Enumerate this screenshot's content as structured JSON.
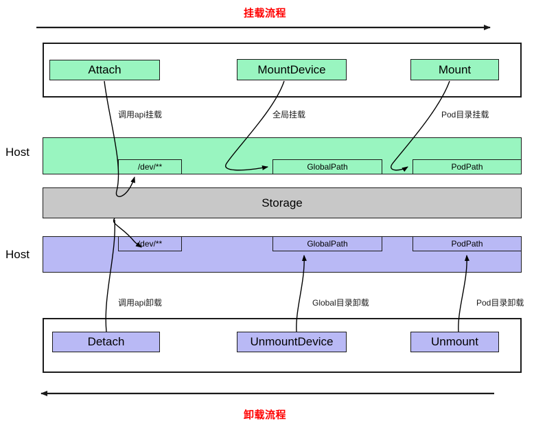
{
  "diagram": {
    "title_mount_flow": "挂载流程",
    "title_unmount_flow": "卸载流程",
    "colors": {
      "mount_accent": "#99F5C0",
      "unmount_accent": "#B9B9F5",
      "storage": "#C8C8C8",
      "flow_title": "#FF0000",
      "stroke": "#1A1A1A"
    }
  },
  "mount_flow": {
    "arrow_direction": "right",
    "stages": [
      {
        "label": "Attach"
      },
      {
        "label": "MountDevice"
      },
      {
        "label": "Mount"
      }
    ],
    "annotations": [
      {
        "label": "调用api挂载"
      },
      {
        "label": "全局挂载"
      },
      {
        "label": "Pod目录挂载"
      }
    ]
  },
  "unmount_flow": {
    "arrow_direction": "left",
    "stages": [
      {
        "label": "Detach"
      },
      {
        "label": "UnmountDevice"
      },
      {
        "label": "Unmount"
      }
    ],
    "annotations": [
      {
        "label": "调用api卸载"
      },
      {
        "label": "Global目录卸载"
      },
      {
        "label": "Pod目录卸载"
      }
    ]
  },
  "bands": {
    "host_top": {
      "label": "Host",
      "chips": [
        {
          "label": "/dev/**"
        },
        {
          "label": "GlobalPath"
        },
        {
          "label": "PodPath"
        }
      ]
    },
    "storage": {
      "label": "Storage"
    },
    "host_bottom": {
      "label": "Host",
      "chips": [
        {
          "label": "/dev/**"
        },
        {
          "label": "GlobalPath"
        },
        {
          "label": "PodPath"
        }
      ]
    }
  }
}
